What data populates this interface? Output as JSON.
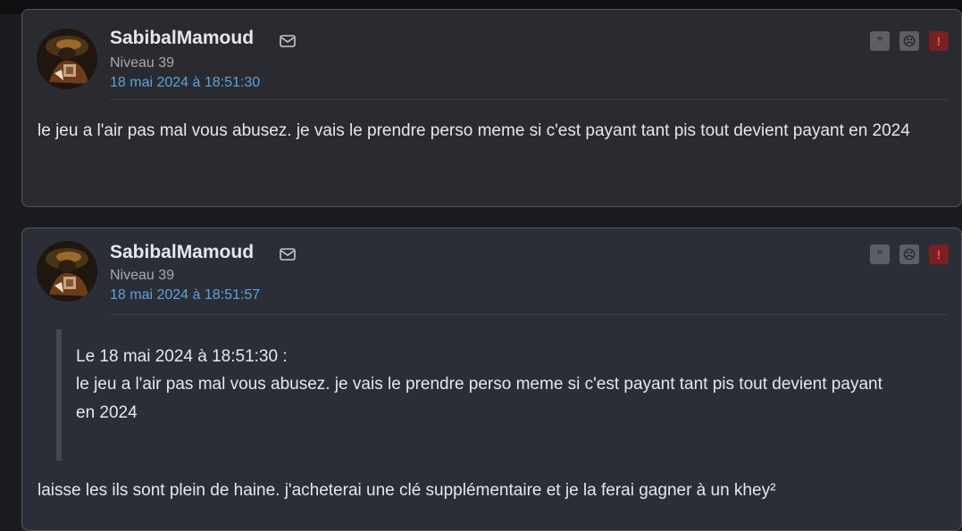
{
  "posts": [
    {
      "author": "SabibalMamoud",
      "level": "Niveau 39",
      "date": "18 mai 2024 à 18:51:30",
      "message": "le jeu a l'air pas mal vous abusez. je vais le prendre perso meme si c'est payant tant pis tout devient payant en 2024",
      "actions": {
        "quote_glyph": "”",
        "ignore_glyph": "☹",
        "report_glyph": "!"
      }
    },
    {
      "author": "SabibalMamoud",
      "level": "Niveau 39",
      "date": "18 mai 2024 à 18:51:57",
      "quote": {
        "header": "Le 18 mai 2024 à 18:51:30 :",
        "body": "le jeu a l'air pas mal vous abusez. je vais le prendre perso meme si c'est payant tant pis tout devient payant en 2024"
      },
      "message": "laisse les ils sont plein de haine. j'acheterai une clé supplémentaire et je la ferai gagner à un khey²",
      "actions": {
        "quote_glyph": "”",
        "ignore_glyph": "☹",
        "report_glyph": "!"
      }
    }
  ],
  "colors": {
    "background": "#1b1c20",
    "post_background": "#2a2b30",
    "date_link": "#5aa2de",
    "report_button": "#7a1f22"
  }
}
